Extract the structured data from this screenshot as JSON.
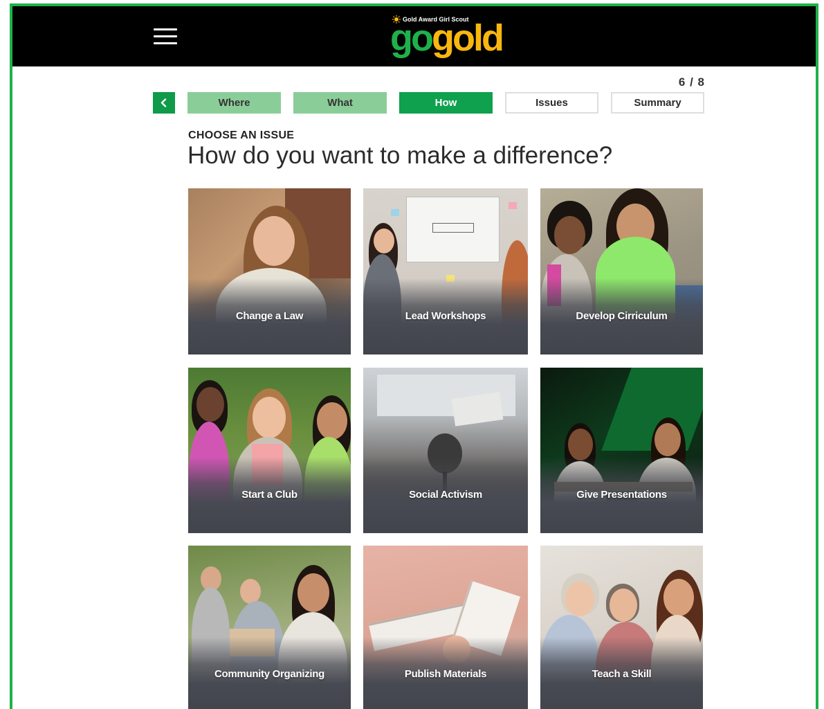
{
  "header": {
    "menu_icon": "hamburger-menu-icon",
    "logo": {
      "tagline": "Gold Award Girl Scout",
      "word_go": "go",
      "word_gold": "gold",
      "colors": {
        "go": "#1eb14b",
        "gold": "#f9b70f"
      }
    }
  },
  "progress": {
    "counter": "6 / 8",
    "back_icon": "chevron-left-icon",
    "steps": [
      {
        "label": "Where",
        "state": "done"
      },
      {
        "label": "What",
        "state": "done"
      },
      {
        "label": "How",
        "state": "current"
      },
      {
        "label": "Issues",
        "state": "todo"
      },
      {
        "label": "Summary",
        "state": "todo"
      }
    ]
  },
  "main": {
    "kicker": "CHOOSE AN ISSUE",
    "title": "How do you want to make a difference?",
    "options": [
      {
        "label": "Change a Law"
      },
      {
        "label": "Lead Workshops"
      },
      {
        "label": "Develop Cirriculum"
      },
      {
        "label": "Start a Club"
      },
      {
        "label": "Social Activism"
      },
      {
        "label": "Give Presentations"
      },
      {
        "label": "Community Organizing"
      },
      {
        "label": "Publish Materials"
      },
      {
        "label": "Teach a Skill"
      }
    ]
  },
  "theme": {
    "frame_border": "#1eb14b",
    "header_bg": "#000000",
    "step_done": "#8bcd98",
    "step_current": "#0fa14e",
    "back_button": "#0f9b4a"
  }
}
